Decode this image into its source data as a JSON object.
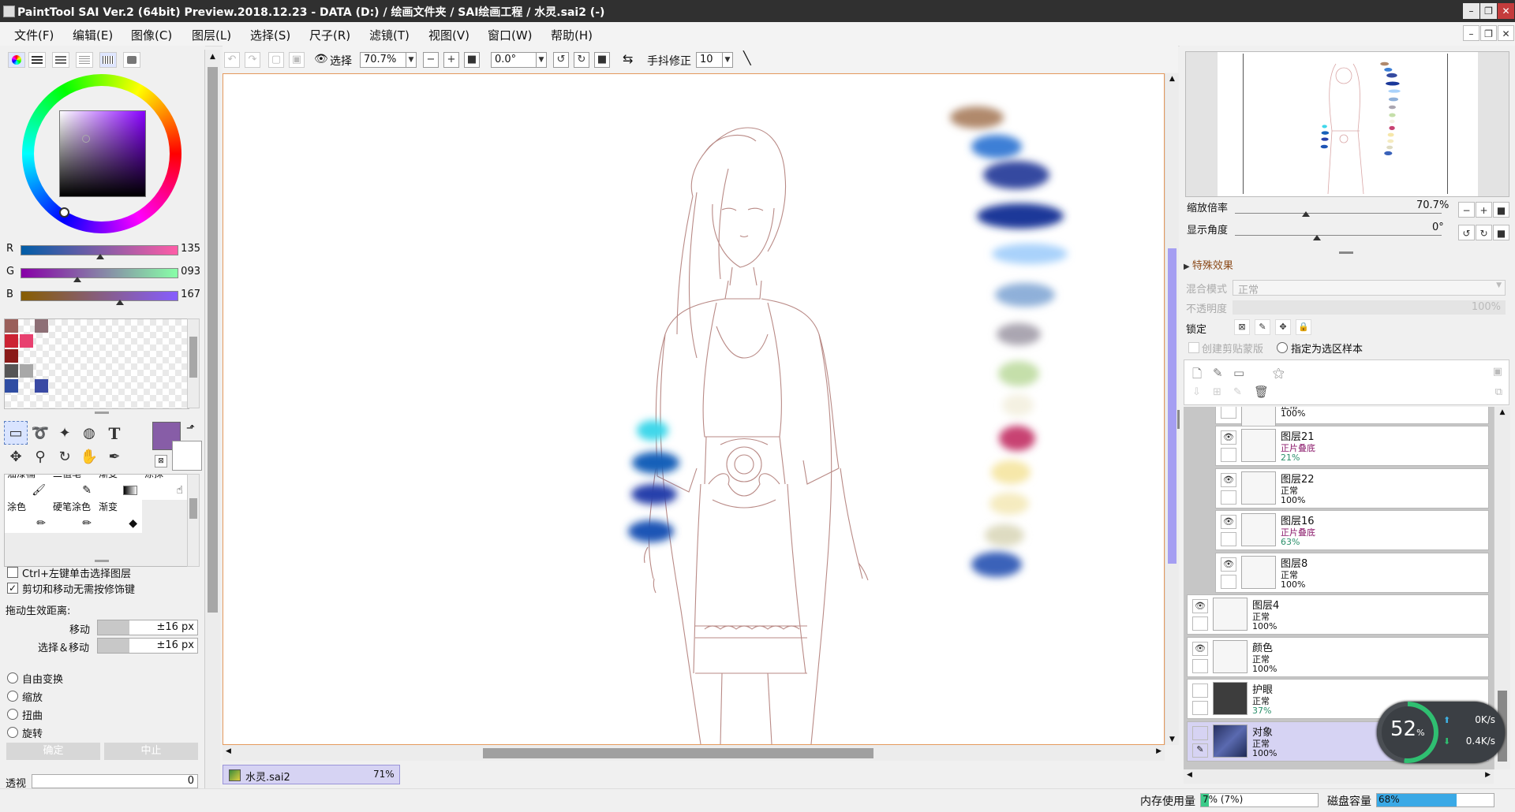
{
  "title": "PaintTool SAI Ver.2 (64bit) Preview.2018.12.23 - DATA (D:) / 绘画文件夹 / SAI绘画工程 / 水灵.sai2 (-)",
  "menu": [
    "文件(F)",
    "编辑(E)",
    "图像(C)",
    "图层(L)",
    "选择(S)",
    "尺子(R)",
    "滤镜(T)",
    "视图(V)",
    "窗口(W)",
    "帮助(H)"
  ],
  "colors": {
    "accent": "#ff6a3d",
    "current_color": "#875da7",
    "canvas_border": "#e59a5d",
    "layer_selected": "#d6d3f3",
    "scroll_thumb": "#a59ef2"
  },
  "rgb": {
    "r_label": "R",
    "r": "135",
    "g_label": "G",
    "g": "093",
    "b_label": "B",
    "b": "167"
  },
  "swatches": [
    "#9a5f5a",
    "#ffffff",
    "#8e6f76",
    "#cc2233",
    "#e8406f",
    "#ffffff",
    "#8a1a18",
    "#ffffff",
    "#ffffff",
    "#555555",
    "#a8a8a8",
    "#ffffff",
    "#2f4da3",
    "#ffffff",
    "#3a4aa4"
  ],
  "tools": {
    "icons": [
      "rectangle-select-icon",
      "lasso-icon",
      "magic-wand-icon",
      "bucket-icon",
      "text-icon",
      "move-icon",
      "zoom-icon",
      "rotate-icon",
      "hand-icon",
      "eyedropper-icon"
    ],
    "text_tool": "T"
  },
  "brushes": {
    "row1": [
      "油漆桶",
      "二值笔",
      "渐变",
      "涂抹"
    ],
    "row2": [
      "涂色",
      "硬笔涂色",
      "渐变"
    ]
  },
  "options": {
    "ctrl_select": "Ctrl+左键单击选择图层",
    "cut_move": "剪切和移动无需按修饰键",
    "drag_label": "拖动生效距离:",
    "move_label": "移动",
    "move_value": "±16 px",
    "select_move_label": "选择＆移动",
    "select_move_value": "±16 px",
    "radios": [
      "自由变换",
      "缩放",
      "扭曲",
      "旋转"
    ],
    "ok": "确定",
    "stop": "中止",
    "perspective_label": "透视",
    "perspective_value": "0"
  },
  "toolbar": {
    "select_label": "选择",
    "zoom": "70.7%",
    "angle": "0.0°",
    "stabilizer_label": "手抖修正",
    "stabilizer_value": "10"
  },
  "navigator": {
    "zoom_label": "缩放倍率",
    "zoom_value": "70.7%",
    "angle_label": "显示角度",
    "angle_value": "0°"
  },
  "layer_props": {
    "section": "特殊效果",
    "blend_label": "混合模式",
    "blend_value": "正常",
    "opacity_label": "不透明度",
    "opacity_value": "100%",
    "lock_label": "锁定",
    "clip_label": "创建剪贴蒙版",
    "sample_label": "指定为选区样本"
  },
  "layers": [
    {
      "name": "",
      "mode": "正常",
      "opacity": "100%",
      "mode_color": "#111111"
    },
    {
      "name": "图层21",
      "mode": "正片叠底",
      "opacity": "21%",
      "mode_color": "#8b1a6b"
    },
    {
      "name": "图层22",
      "mode": "正常",
      "opacity": "100%",
      "mode_color": "#111111"
    },
    {
      "name": "图层16",
      "mode": "正片叠底",
      "opacity": "63%",
      "mode_color": "#8b1a6b"
    },
    {
      "name": "图层8",
      "mode": "正常",
      "opacity": "100%",
      "mode_color": "#111111"
    },
    {
      "name": "图层4",
      "mode": "正常",
      "opacity": "100%",
      "mode_color": "#111111"
    },
    {
      "name": "颜色",
      "mode": "正常",
      "opacity": "100%",
      "mode_color": "#111111"
    },
    {
      "name": "护眼",
      "mode": "正常",
      "opacity": "37%",
      "mode_color": "#111111"
    },
    {
      "name": "对象",
      "mode": "正常",
      "opacity": "100%",
      "mode_color": "#111111"
    }
  ],
  "document_tab": {
    "name": "水灵.sai2",
    "zoom": "71%"
  },
  "monitor": {
    "percent": "52",
    "percent_unit": "%",
    "up": "0K/s",
    "down": "0.4K/s"
  },
  "status": {
    "memory_label": "内存使用量",
    "memory_value": "7% (7%)",
    "memory_fraction": 0.07,
    "disk_label": "磁盘容量",
    "disk_value": "68%",
    "disk_fraction": 0.68
  },
  "canvas_blobs": [
    {
      "color": "#b0896c"
    },
    {
      "color": "#3c7fd6"
    },
    {
      "color": "#344aa0"
    },
    {
      "color": "#1a3799"
    },
    {
      "color": "#a9d2fb"
    },
    {
      "color": "#8fb0d9"
    },
    {
      "color": "#aaa6b1"
    },
    {
      "color": "#c5dfaa"
    },
    {
      "color": "#f4f1e2"
    },
    {
      "color": "#c84272"
    },
    {
      "color": "#f6e7a9"
    },
    {
      "color": "#f5ebbf"
    },
    {
      "color": "#dedbc1"
    },
    {
      "color": "#3a62b9"
    },
    {
      "color": "#3fd7ea"
    },
    {
      "color": "#1861b9"
    },
    {
      "color": "#2841ab"
    },
    {
      "color": "#1d54b5"
    }
  ]
}
